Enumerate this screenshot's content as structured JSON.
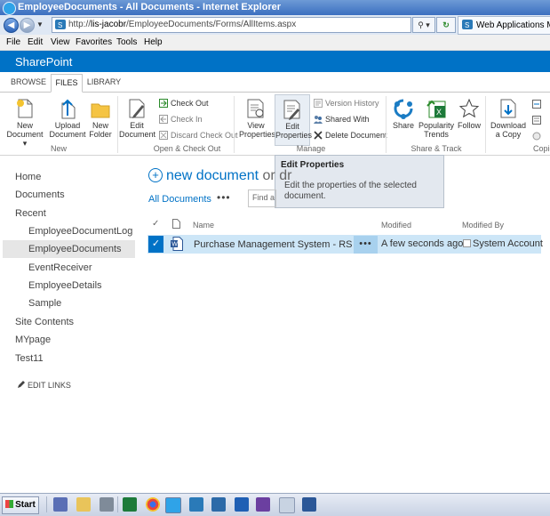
{
  "window": {
    "title": "EmployeeDocuments - All Documents - Internet Explorer"
  },
  "browser": {
    "url_prefix": "http://",
    "url_host": "lis-jacobr",
    "url_path": "/EmployeeDocuments/Forms/AllItems.aspx",
    "second_tab_title": "Web Applications Manag",
    "menu": [
      "File",
      "Edit",
      "View",
      "Favorites",
      "Tools",
      "Help"
    ]
  },
  "suite_bar": {
    "title": "SharePoint"
  },
  "ribbon": {
    "tabs": [
      "BROWSE",
      "FILES",
      "LIBRARY"
    ],
    "active_tab": "FILES",
    "new_group": {
      "label": "New",
      "new_document": "New Document",
      "upload_document": "Upload Document",
      "new_folder": "New Folder"
    },
    "open_group": {
      "label": "Open & Check Out",
      "edit_document": "Edit Document",
      "check_out": "Check Out",
      "check_in": "Check In",
      "discard_check_out": "Discard Check Out"
    },
    "manage_group": {
      "label": "Manage",
      "view_properties": "View Properties",
      "edit_properties": "Edit Properties",
      "version_history": "Version History",
      "shared_with": "Shared With",
      "delete_document": "Delete Document"
    },
    "share_group": {
      "label": "Share & Track",
      "share": "Share",
      "popularity_trends": "Popularity Trends",
      "follow": "Follow"
    },
    "copies_group": {
      "label": "Copie",
      "download_copy": "Download a Copy"
    }
  },
  "tooltip": {
    "title": "Edit Properties",
    "description": "Edit the properties of the selected document."
  },
  "left_nav": {
    "items": [
      "Home",
      "Documents",
      "Recent"
    ],
    "recent_items": [
      "EmployeeDocumentLog",
      "EmployeeDocuments",
      "EventReceiver",
      "EmployeeDetails",
      "Sample"
    ],
    "bottom_items": [
      "Site Contents",
      "MYpage",
      "Test11"
    ],
    "edit_links": "EDIT LINKS"
  },
  "library": {
    "new_document": "new document",
    "new_document_suffix": "or dr",
    "view_name": "All Documents",
    "view_menu": "•••",
    "find_placeholder": "Find a",
    "columns": {
      "name": "Name",
      "modified": "Modified",
      "modified_by": "Modified By"
    },
    "rows": [
      {
        "name": "Purchase Management System - RS",
        "new_marker": "¤",
        "ellipsis": "•••",
        "modified": "A few seconds ago",
        "modified_by": "System Account"
      }
    ]
  },
  "taskbar": {
    "start_label": "Start"
  },
  "colors": {
    "suite_bar": "#0072c6",
    "selected_row": "#cde6f7",
    "link": "#0072c6"
  }
}
